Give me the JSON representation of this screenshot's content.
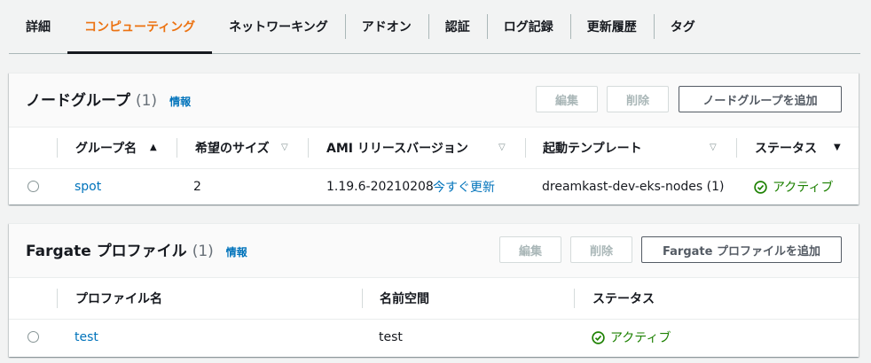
{
  "tabs": [
    {
      "label": "詳細",
      "active": false
    },
    {
      "label": "コンピューティング",
      "active": true
    },
    {
      "label": "ネットワーキング",
      "active": false
    },
    {
      "label": "アドオン",
      "active": false
    },
    {
      "label": "認証",
      "active": false
    },
    {
      "label": "ログ記録",
      "active": false
    },
    {
      "label": "更新履歴",
      "active": false
    },
    {
      "label": "タグ",
      "active": false
    }
  ],
  "node_groups": {
    "title": "ノードグループ",
    "count": "(1)",
    "info": "情報",
    "edit_label": "編集",
    "delete_label": "削除",
    "add_label": "ノードグループを追加",
    "columns": [
      "グループ名",
      "希望のサイズ",
      "AMI リリースバージョン",
      "起動テンプレート",
      "ステータス"
    ],
    "rows": [
      {
        "name": "spot",
        "desired_size": "2",
        "ami_version": "1.19.6-20210208",
        "update_link": "今すぐ更新",
        "launch_template": "dreamkast-dev-eks-nodes (1)",
        "status": "アクティブ"
      }
    ]
  },
  "fargate": {
    "title": "Fargate プロファイル",
    "count": "(1)",
    "info": "情報",
    "edit_label": "編集",
    "delete_label": "削除",
    "add_label": "Fargate プロファイルを追加",
    "columns": [
      "プロファイル名",
      "名前空間",
      "ステータス"
    ],
    "rows": [
      {
        "name": "test",
        "namespace": "test",
        "status": "アクティブ"
      }
    ]
  },
  "colors": {
    "accent": "#ec7211",
    "link": "#0073bb",
    "success": "#1d8102"
  }
}
